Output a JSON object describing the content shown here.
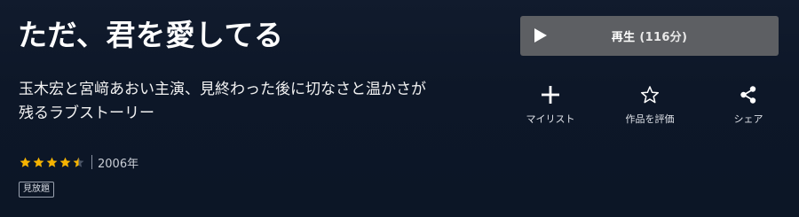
{
  "title": "ただ、君を愛してる",
  "description": "玉木宏と宮﨑あおい主演、見終わった後に切なさと温かさが残るラブストーリー",
  "rating": {
    "value": 4.5,
    "max": 5,
    "star_color": "#f5b301",
    "empty_color": "#4a5466"
  },
  "year": "2006年",
  "badge": "見放題",
  "play": {
    "label": "再生",
    "duration": "(116分)",
    "icon": "play-icon",
    "bg_color": "#5d5f63"
  },
  "actions": [
    {
      "label": "マイリスト",
      "icon": "plus-icon"
    },
    {
      "label": "作品を評価",
      "icon": "star-outline-icon"
    },
    {
      "label": "シェア",
      "icon": "share-icon"
    }
  ]
}
